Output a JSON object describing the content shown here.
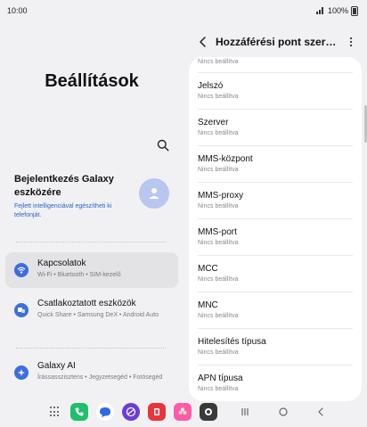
{
  "status_bar": {
    "time": "10:00",
    "battery": "100%"
  },
  "left": {
    "title": "Beállítások",
    "account": {
      "title": "Bejelentkezés Galaxy eszközére",
      "subtitle": "Fejlett intelligenciával egészítheti ki telefonját."
    },
    "items": [
      {
        "title": "Kapcsolatok",
        "subtitle": "Wi-Fi • Bluetooth • SIM-kezelő",
        "icon": "wifi-icon",
        "color": "#3d6ee0",
        "active": true
      },
      {
        "title": "Csatlakoztatott eszközök",
        "subtitle": "Quick Share • Samsung DeX • Android Auto",
        "icon": "devices-icon",
        "color": "#3d6ee0",
        "active": false
      },
      {
        "title": "Galaxy AI",
        "subtitle": "Írássasszisztens • Jegyzetsegéd • Fotósegéd",
        "icon": "galaxy-ai-icon",
        "color": "#3d6ee0",
        "active": false
      }
    ]
  },
  "right": {
    "title": "Hozzáférési pont szer…",
    "top_partial_value": "Nincs beállítva",
    "rows": [
      {
        "title": "Jelszó",
        "value": "Nincs beállítva"
      },
      {
        "title": "Szerver",
        "value": "Nincs beállítva"
      },
      {
        "title": "MMS-központ",
        "value": "Nincs beállítva"
      },
      {
        "title": "MMS-proxy",
        "value": "Nincs beállítva"
      },
      {
        "title": "MMS-port",
        "value": "Nincs beállítva"
      },
      {
        "title": "MCC",
        "value": "Nincs beállítva"
      },
      {
        "title": "MNC",
        "value": "Nincs beállítva"
      },
      {
        "title": "Hitelesítés típusa",
        "value": "Nincs beállítva"
      },
      {
        "title": "APN típusa",
        "value": "Nincs beállítva"
      }
    ]
  },
  "dock": {
    "apps": [
      "phone-app-icon",
      "messages-app-icon",
      "browser-app-icon",
      "store-app-icon",
      "gallery-app-icon",
      "camera-app-icon"
    ],
    "nav": [
      "recents-button",
      "home-button",
      "back-button"
    ]
  }
}
